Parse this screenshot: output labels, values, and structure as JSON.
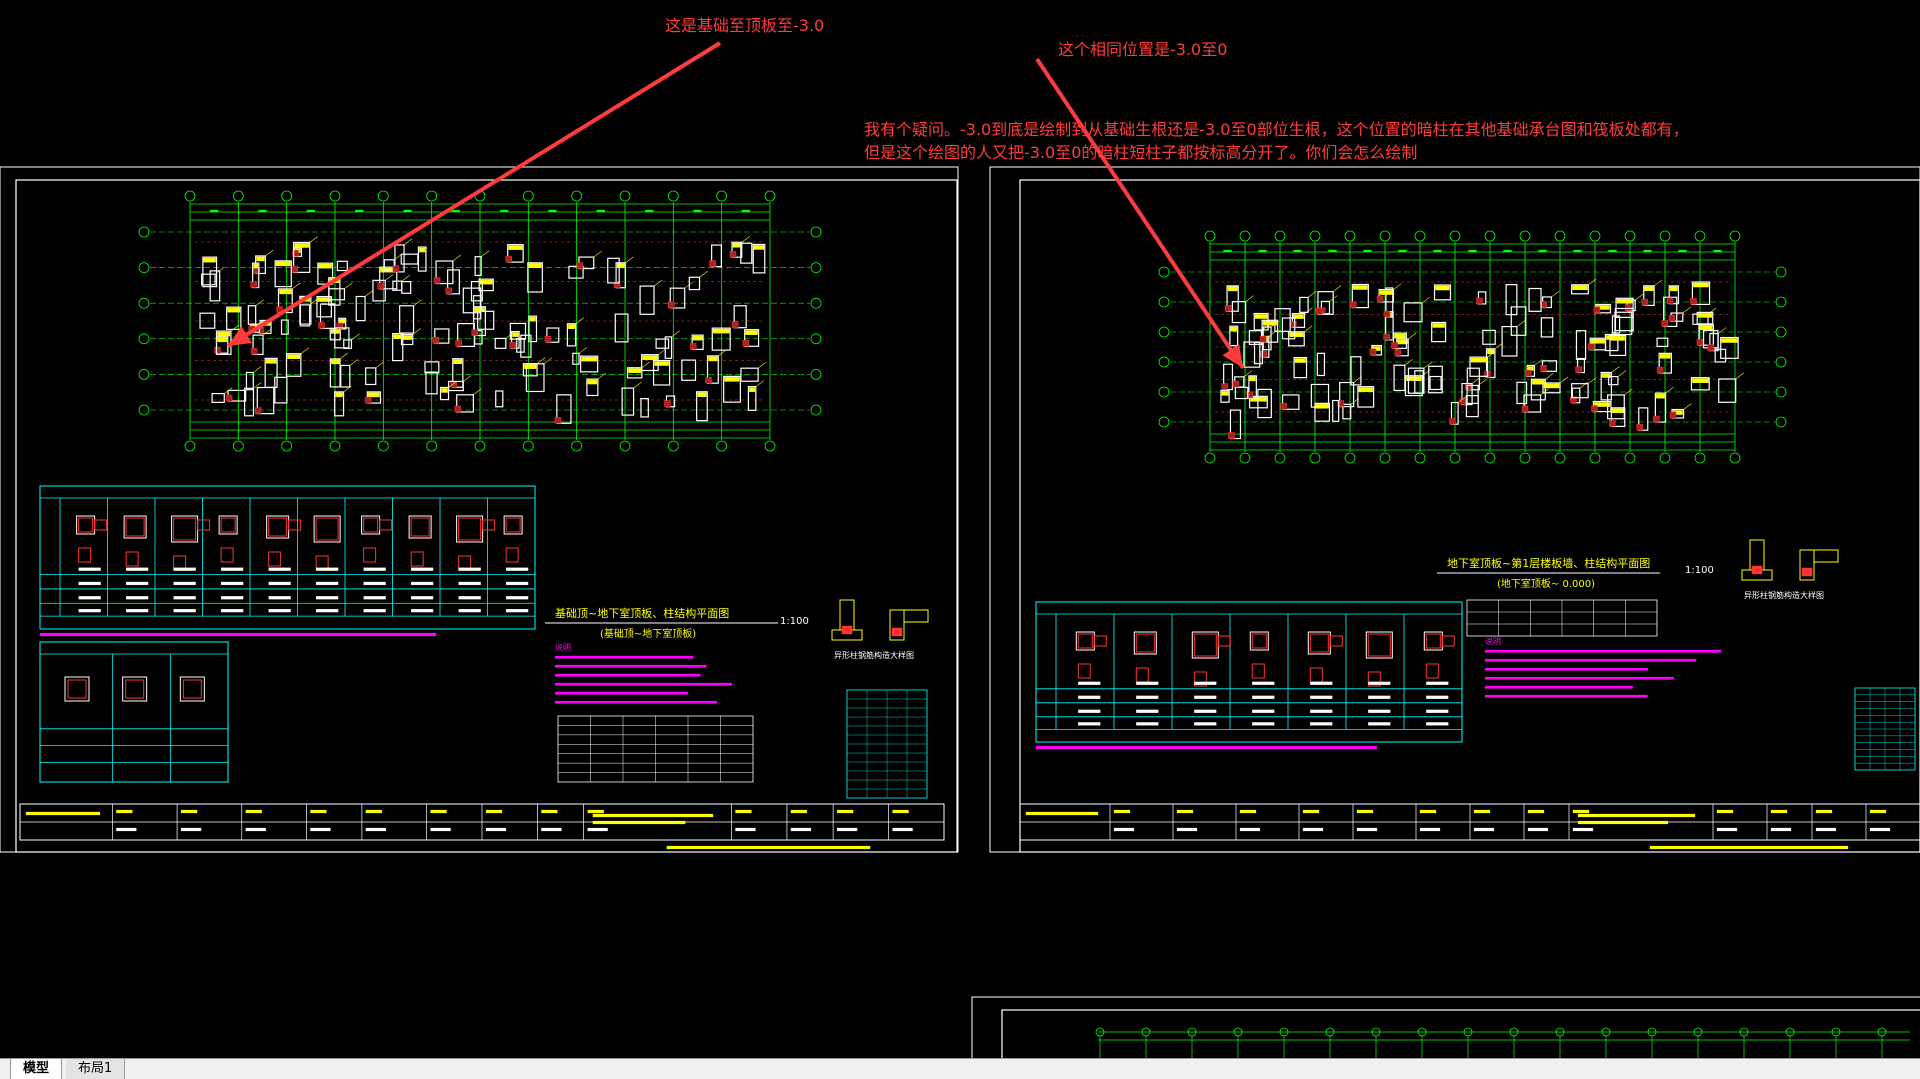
{
  "annotations": {
    "note1": "这是基础至顶板至-3.0",
    "note2": "这个相同位置是-3.0至0",
    "question_line1": "我有个疑问。-3.0到底是绘制到从基础生根还是-3.0至0部位生根，这个位置的暗柱在其他基础承台图和筏板处都有，",
    "question_line2": "但是这个绘图的人又把-3.0至0的暗柱短柱子都按标高分开了。你们会怎么绘制",
    "color": "#ff3b3b"
  },
  "drawing_left": {
    "title": "基础顶~地下室顶板、柱结构平面图",
    "subtitle": "(基础顶~地下室顶板)",
    "scale": "1:100",
    "detail_label": "异形柱钢筋构造大样图"
  },
  "drawing_right": {
    "title": "地下室顶板~第1层楼板墙、柱结构平面图",
    "subtitle": "(地下室顶板~ 0.000)",
    "scale": "1:100",
    "detail_label": "异形柱钢筋构造大样图"
  },
  "colors": {
    "background": "#000000",
    "frame": "#ffffff",
    "grid_axis": "#00ff00",
    "column_fill": "#ffffff",
    "rebar": "#ff3333",
    "hatch": "#ffff00",
    "table": "#00ffff",
    "notes": "#ff00ff"
  },
  "tabs": [
    {
      "label": "模型",
      "active": true
    },
    {
      "label": "布局1",
      "active": false
    }
  ]
}
